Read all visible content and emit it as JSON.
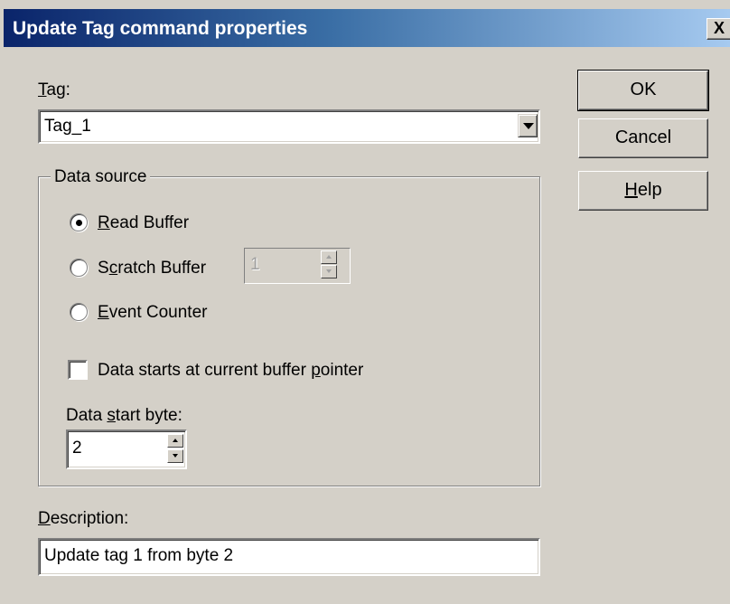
{
  "window": {
    "title": "Update Tag command properties",
    "close_symbol": "X"
  },
  "tag": {
    "label_accel": "T",
    "label_rest": "ag:",
    "value": "Tag_1"
  },
  "data_source": {
    "title": "Data source",
    "options": [
      {
        "accel": "R",
        "rest": "ead Buffer",
        "checked": true
      },
      {
        "pre": "S",
        "accel": "c",
        "rest": "ratch Buffer",
        "checked": false
      },
      {
        "accel": "E",
        "rest": "vent Counter",
        "checked": false
      }
    ],
    "scratch_buffer_value": "1",
    "scratch_buffer_enabled": false
  },
  "pointer_checkbox": {
    "pre": "Data starts at current buffer ",
    "accel": "p",
    "rest": "ointer",
    "checked": false
  },
  "start_byte": {
    "pre": "Data ",
    "accel": "s",
    "rest": "tart byte:",
    "value": "2"
  },
  "description": {
    "label_accel": "D",
    "label_rest": "escription:",
    "value": "Update tag 1 from byte 2"
  },
  "buttons": {
    "ok": "OK",
    "cancel": "Cancel",
    "help_accel": "H",
    "help_rest": "elp"
  },
  "icons": {
    "dropdown": "chevron-down-icon",
    "spin_up": "spin-up-icon",
    "spin_down": "spin-down-icon",
    "close": "close-icon"
  },
  "colors": {
    "dialog_face": "#d4d0c8",
    "titlebar_start": "#0a246a",
    "titlebar_end": "#a6caf0"
  }
}
